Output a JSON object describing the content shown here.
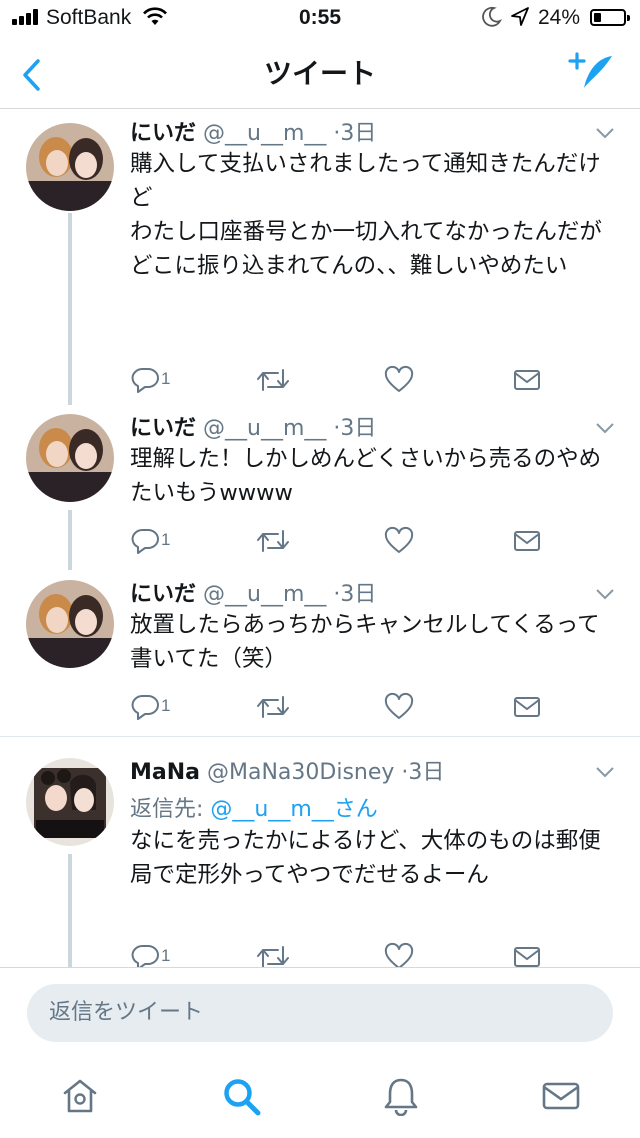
{
  "status_bar": {
    "carrier": "SoftBank",
    "time": "0:55",
    "battery": "24%"
  },
  "nav": {
    "title": "ツイート"
  },
  "tweets": [
    {
      "name": "にいだ",
      "handle": "@__u__m__",
      "dot": "·",
      "time": "3日",
      "text": "購入して支払いされましたって通知きたんだけど\nわたし口座番号とか一切入れてなかったんだが\nどこに振り込まれてんの、、難しいやめたい",
      "reply_count": "1"
    },
    {
      "name": "にいだ",
      "handle": "@__u__m__",
      "dot": "·",
      "time": "3日",
      "text": "理解した！しかしめんどくさいから売るのやめたいもうwwww",
      "reply_count": "1"
    },
    {
      "name": "にいだ",
      "handle": "@__u__m__",
      "dot": "·",
      "time": "3日",
      "text": "放置したらあっちからキャンセルしてくるって書いてた（笑）",
      "reply_count": "1"
    },
    {
      "name": "MaNa",
      "handle": "@MaNa30Disney",
      "dot": "·",
      "time": "3日",
      "reply_prefix": "返信先: ",
      "reply_to": "@__u__m__さん",
      "text": "なにを売ったかによるけど、大体のものは郵便局で定形外ってやつでだせるよーん",
      "reply_count": "1"
    }
  ],
  "reply_bar": {
    "placeholder": "返信をツイート"
  },
  "colors": {
    "accent": "#1da1f2",
    "muted": "#657786",
    "thread_line": "#ccd6dd"
  },
  "icons": [
    "back-chevron-icon",
    "compose-tweet-icon",
    "reply-icon",
    "retweet-icon",
    "like-icon",
    "dm-icon",
    "home-icon",
    "search-icon",
    "notifications-icon",
    "messages-icon"
  ]
}
